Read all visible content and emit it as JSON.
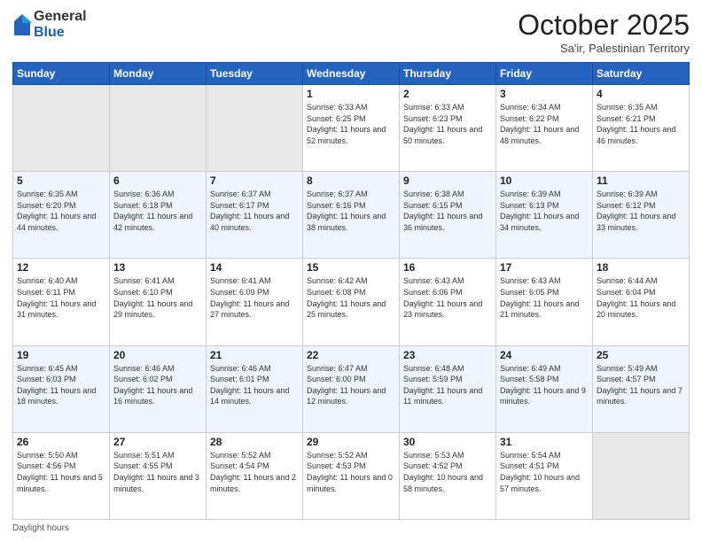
{
  "header": {
    "logo_general": "General",
    "logo_blue": "Blue",
    "month_title": "October 2025",
    "location": "Sa'ir, Palestinian Territory"
  },
  "days_of_week": [
    "Sunday",
    "Monday",
    "Tuesday",
    "Wednesday",
    "Thursday",
    "Friday",
    "Saturday"
  ],
  "footer": {
    "daylight_label": "Daylight hours"
  },
  "weeks": [
    [
      {
        "num": "",
        "empty": true
      },
      {
        "num": "",
        "empty": true
      },
      {
        "num": "",
        "empty": true
      },
      {
        "num": "1",
        "sunrise": "6:33 AM",
        "sunset": "6:25 PM",
        "daylight": "11 hours and 52 minutes."
      },
      {
        "num": "2",
        "sunrise": "6:33 AM",
        "sunset": "6:23 PM",
        "daylight": "11 hours and 50 minutes."
      },
      {
        "num": "3",
        "sunrise": "6:34 AM",
        "sunset": "6:22 PM",
        "daylight": "11 hours and 48 minutes."
      },
      {
        "num": "4",
        "sunrise": "6:35 AM",
        "sunset": "6:21 PM",
        "daylight": "11 hours and 46 minutes."
      }
    ],
    [
      {
        "num": "5",
        "sunrise": "6:35 AM",
        "sunset": "6:20 PM",
        "daylight": "11 hours and 44 minutes."
      },
      {
        "num": "6",
        "sunrise": "6:36 AM",
        "sunset": "6:18 PM",
        "daylight": "11 hours and 42 minutes."
      },
      {
        "num": "7",
        "sunrise": "6:37 AM",
        "sunset": "6:17 PM",
        "daylight": "11 hours and 40 minutes."
      },
      {
        "num": "8",
        "sunrise": "6:37 AM",
        "sunset": "6:16 PM",
        "daylight": "11 hours and 38 minutes."
      },
      {
        "num": "9",
        "sunrise": "6:38 AM",
        "sunset": "6:15 PM",
        "daylight": "11 hours and 36 minutes."
      },
      {
        "num": "10",
        "sunrise": "6:39 AM",
        "sunset": "6:13 PM",
        "daylight": "11 hours and 34 minutes."
      },
      {
        "num": "11",
        "sunrise": "6:39 AM",
        "sunset": "6:12 PM",
        "daylight": "11 hours and 33 minutes."
      }
    ],
    [
      {
        "num": "12",
        "sunrise": "6:40 AM",
        "sunset": "6:11 PM",
        "daylight": "11 hours and 31 minutes."
      },
      {
        "num": "13",
        "sunrise": "6:41 AM",
        "sunset": "6:10 PM",
        "daylight": "11 hours and 29 minutes."
      },
      {
        "num": "14",
        "sunrise": "6:41 AM",
        "sunset": "6:09 PM",
        "daylight": "11 hours and 27 minutes."
      },
      {
        "num": "15",
        "sunrise": "6:42 AM",
        "sunset": "6:08 PM",
        "daylight": "11 hours and 25 minutes."
      },
      {
        "num": "16",
        "sunrise": "6:43 AM",
        "sunset": "6:06 PM",
        "daylight": "11 hours and 23 minutes."
      },
      {
        "num": "17",
        "sunrise": "6:43 AM",
        "sunset": "6:05 PM",
        "daylight": "11 hours and 21 minutes."
      },
      {
        "num": "18",
        "sunrise": "6:44 AM",
        "sunset": "6:04 PM",
        "daylight": "11 hours and 20 minutes."
      }
    ],
    [
      {
        "num": "19",
        "sunrise": "6:45 AM",
        "sunset": "6:03 PM",
        "daylight": "11 hours and 18 minutes."
      },
      {
        "num": "20",
        "sunrise": "6:46 AM",
        "sunset": "6:02 PM",
        "daylight": "11 hours and 16 minutes."
      },
      {
        "num": "21",
        "sunrise": "6:46 AM",
        "sunset": "6:01 PM",
        "daylight": "11 hours and 14 minutes."
      },
      {
        "num": "22",
        "sunrise": "6:47 AM",
        "sunset": "6:00 PM",
        "daylight": "11 hours and 12 minutes."
      },
      {
        "num": "23",
        "sunrise": "6:48 AM",
        "sunset": "5:59 PM",
        "daylight": "11 hours and 11 minutes."
      },
      {
        "num": "24",
        "sunrise": "6:49 AM",
        "sunset": "5:58 PM",
        "daylight": "11 hours and 9 minutes."
      },
      {
        "num": "25",
        "sunrise": "5:49 AM",
        "sunset": "4:57 PM",
        "daylight": "11 hours and 7 minutes."
      }
    ],
    [
      {
        "num": "26",
        "sunrise": "5:50 AM",
        "sunset": "4:56 PM",
        "daylight": "11 hours and 5 minutes."
      },
      {
        "num": "27",
        "sunrise": "5:51 AM",
        "sunset": "4:55 PM",
        "daylight": "11 hours and 3 minutes."
      },
      {
        "num": "28",
        "sunrise": "5:52 AM",
        "sunset": "4:54 PM",
        "daylight": "11 hours and 2 minutes."
      },
      {
        "num": "29",
        "sunrise": "5:52 AM",
        "sunset": "4:53 PM",
        "daylight": "11 hours and 0 minutes."
      },
      {
        "num": "30",
        "sunrise": "5:53 AM",
        "sunset": "4:52 PM",
        "daylight": "10 hours and 58 minutes."
      },
      {
        "num": "31",
        "sunrise": "5:54 AM",
        "sunset": "4:51 PM",
        "daylight": "10 hours and 57 minutes."
      },
      {
        "num": "",
        "empty": true
      }
    ]
  ]
}
